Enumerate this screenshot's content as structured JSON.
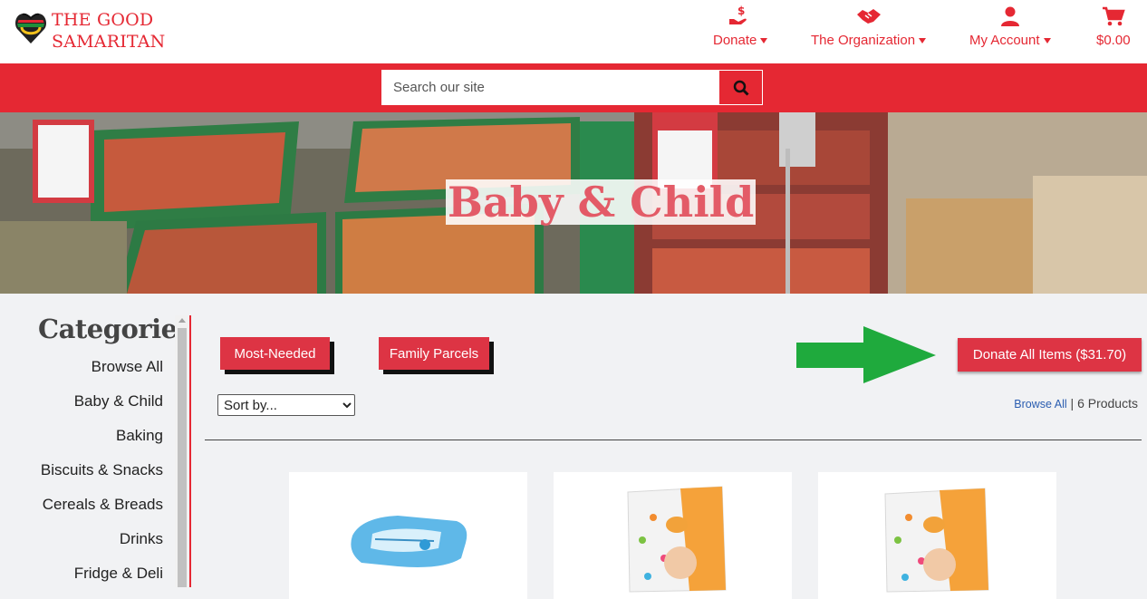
{
  "brand": {
    "line1": "THE GOOD",
    "line2": "SAMARITAN"
  },
  "nav": [
    {
      "label": "Donate",
      "icon": "hand-dollar-icon"
    },
    {
      "label": "The Organization",
      "icon": "handshake-icon"
    },
    {
      "label": "My Account",
      "icon": "user-icon"
    },
    {
      "label": "$0.00",
      "icon": "cart-icon"
    }
  ],
  "search": {
    "placeholder": "Search our site"
  },
  "hero": {
    "title": "Baby & Child"
  },
  "sidebar": {
    "title": "Categories",
    "items": [
      "Browse All",
      "Baby & Child",
      "Baking",
      "Biscuits & Snacks",
      "Cereals & Breads",
      "Drinks",
      "Fridge & Deli"
    ]
  },
  "toolbar": {
    "most_needed": "Most-Needed",
    "family_parcels": "Family Parcels",
    "donate_all": "Donate All Items ($31.70)",
    "sort_option": "Sort by...",
    "browse_all_link": "Browse All",
    "product_count": "6 Products",
    "separator": "|"
  },
  "products": [
    {
      "icon": "baby-wipes-icon"
    },
    {
      "icon": "diapers-pack-icon"
    },
    {
      "icon": "diapers-pack-icon"
    }
  ],
  "colors": {
    "brand_red": "#e52833",
    "button_red": "#dd3444",
    "arrow_green": "#1faa3d"
  }
}
